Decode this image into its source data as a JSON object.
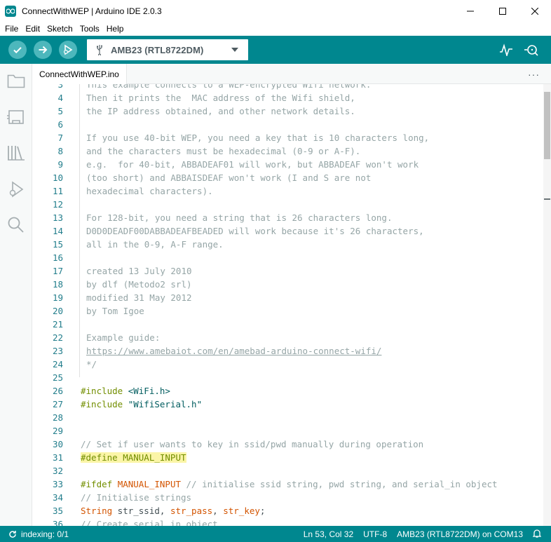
{
  "window": {
    "title": "ConnectWithWEP | Arduino IDE 2.0.3",
    "minimize_icon": "minimize-icon",
    "maximize_icon": "maximize-icon",
    "close_icon": "close-icon"
  },
  "menu": [
    "File",
    "Edit",
    "Sketch",
    "Tools",
    "Help"
  ],
  "toolbar": {
    "verify_icon": "checkmark-icon",
    "upload_icon": "arrow-right-icon",
    "debug_icon": "debug-icon",
    "board": "AMB23 (RTL8722DM)",
    "plotter_icon": "serial-plotter-icon",
    "monitor_icon": "serial-monitor-icon"
  },
  "sidebar": [
    "folder-icon",
    "boards-manager-icon",
    "library-icon",
    "debug-icon",
    "search-icon"
  ],
  "tab": {
    "label": "ConnectWithWEP.ino",
    "more": "···"
  },
  "code": [
    {
      "n": "3",
      "parts": [
        {
          "t": "This example connects to a WEP-encrypted Wifi network.",
          "c": "comment"
        }
      ],
      "partial": true
    },
    {
      "n": "4",
      "parts": [
        {
          "t": "Then it prints the  MAC address of the Wifi shield,",
          "c": "comment"
        }
      ]
    },
    {
      "n": "5",
      "parts": [
        {
          "t": "the IP address obtained, and other network details.",
          "c": "comment"
        }
      ]
    },
    {
      "n": "6",
      "parts": []
    },
    {
      "n": "7",
      "parts": [
        {
          "t": "If you use 40-bit WEP, you need a key that is 10 characters long,",
          "c": "comment"
        }
      ]
    },
    {
      "n": "8",
      "parts": [
        {
          "t": "and the characters must be hexadecimal (0-9 or A-F).",
          "c": "comment"
        }
      ]
    },
    {
      "n": "9",
      "parts": [
        {
          "t": "e.g.  for 40-bit, ABBADEAF01 will work, but ABBADEAF won't work",
          "c": "comment"
        }
      ]
    },
    {
      "n": "10",
      "parts": [
        {
          "t": "(too short) and ABBAISDEAF won't work (I and S are not",
          "c": "comment"
        }
      ]
    },
    {
      "n": "11",
      "parts": [
        {
          "t": "hexadecimal characters).",
          "c": "comment"
        }
      ]
    },
    {
      "n": "12",
      "parts": []
    },
    {
      "n": "13",
      "parts": [
        {
          "t": "For 128-bit, you need a string that is 26 characters long.",
          "c": "comment"
        }
      ]
    },
    {
      "n": "14",
      "parts": [
        {
          "t": "D0D0DEADF00DABBADEAFBEADED will work because it's 26 characters,",
          "c": "comment"
        }
      ]
    },
    {
      "n": "15",
      "parts": [
        {
          "t": "all in the 0-9, A-F range.",
          "c": "comment"
        }
      ]
    },
    {
      "n": "16",
      "parts": []
    },
    {
      "n": "17",
      "parts": [
        {
          "t": "created 13 July 2010",
          "c": "comment"
        }
      ]
    },
    {
      "n": "18",
      "parts": [
        {
          "t": "by dlf (Metodo2 srl)",
          "c": "comment"
        }
      ]
    },
    {
      "n": "19",
      "parts": [
        {
          "t": "modified 31 May 2012",
          "c": "comment"
        }
      ]
    },
    {
      "n": "20",
      "parts": [
        {
          "t": "by Tom Igoe",
          "c": "comment"
        }
      ]
    },
    {
      "n": "21",
      "parts": []
    },
    {
      "n": "22",
      "parts": [
        {
          "t": "Example guide:",
          "c": "comment"
        }
      ]
    },
    {
      "n": "23",
      "parts": [
        {
          "t": "https://www.amebaiot.com/en/amebad-arduino-connect-wifi/",
          "c": "link"
        }
      ]
    },
    {
      "n": "24",
      "parts": [
        {
          "t": "*/",
          "c": "comment"
        }
      ]
    },
    {
      "n": "25",
      "parts": []
    },
    {
      "n": "26",
      "parts": [
        {
          "t": "#include ",
          "c": "pre"
        },
        {
          "t": "<WiFi.h>",
          "c": "str"
        }
      ],
      "root": true
    },
    {
      "n": "27",
      "parts": [
        {
          "t": "#include ",
          "c": "pre"
        },
        {
          "t": "\"WifiSerial.h\"",
          "c": "str"
        }
      ],
      "root": true
    },
    {
      "n": "28",
      "parts": [],
      "root": true
    },
    {
      "n": "29",
      "parts": [],
      "root": true
    },
    {
      "n": "30",
      "parts": [
        {
          "t": "// Set if user wants to key in ssid/pwd manually during operation",
          "c": "comment"
        }
      ],
      "root": true
    },
    {
      "n": "31",
      "parts": [
        {
          "t": "#define MANUAL_INPUT",
          "c": "pre"
        }
      ],
      "root": true,
      "highlight": true
    },
    {
      "n": "32",
      "parts": [],
      "root": true
    },
    {
      "n": "33",
      "parts": [
        {
          "t": "#ifdef ",
          "c": "pre"
        },
        {
          "t": "MANUAL_INPUT",
          "c": "kw"
        },
        {
          "t": " // initialise ssid string, pwd string, and serial_in object",
          "c": "comment"
        }
      ],
      "root": true
    },
    {
      "n": "34",
      "parts": [
        {
          "t": "// Initialise strings",
          "c": "comment"
        }
      ],
      "root": true
    },
    {
      "n": "35",
      "parts": [
        {
          "t": "String",
          "c": "kw"
        },
        {
          "t": " str_ssid, ",
          "c": "norm"
        },
        {
          "t": "str_pass",
          "c": "kw"
        },
        {
          "t": ", ",
          "c": "norm"
        },
        {
          "t": "str_key",
          "c": "kw"
        },
        {
          "t": ";",
          "c": "norm"
        }
      ],
      "root": true
    },
    {
      "n": "36",
      "parts": [
        {
          "t": "// Create serial_in object",
          "c": "comment"
        }
      ],
      "root": true,
      "partial": true
    }
  ],
  "status": {
    "indexing": "indexing: 0/1",
    "position": "Ln 53, Col 32",
    "encoding": "UTF-8",
    "board_port": "AMB23 (RTL8722DM) on COM13",
    "notification_icon": "bell-icon"
  }
}
